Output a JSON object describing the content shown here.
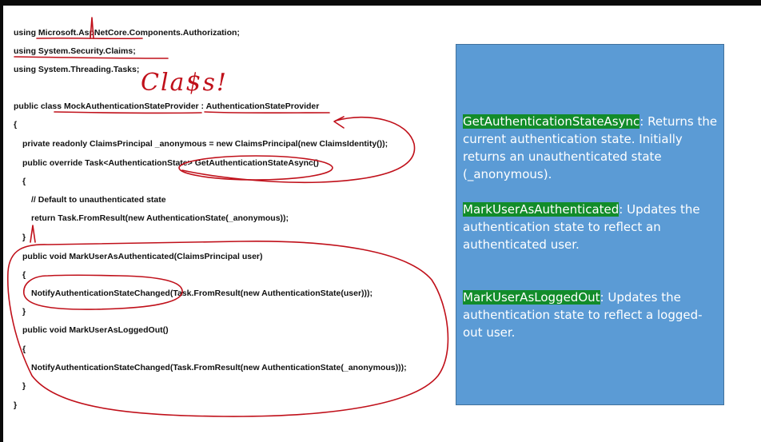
{
  "code": {
    "lines": [
      "using Microsoft.AspNetCore.Components.Authorization;",
      "using System.Security.Claims;",
      "using System.Threading.Tasks;",
      "public class MockAuthenticationStateProvider : AuthenticationStateProvider",
      "{",
      "private readonly ClaimsPrincipal _anonymous = new ClaimsPrincipal(new ClaimsIdentity());",
      "public override Task<AuthenticationState> GetAuthenticationStateAsync()",
      "{",
      "// Default to unauthenticated state",
      "return Task.FromResult(new AuthenticationState(_anonymous));",
      "}",
      "public void MarkUserAsAuthenticated(ClaimsPrincipal user)",
      "{",
      "NotifyAuthenticationStateChanged(Task.FromResult(new AuthenticationState(user)));",
      "}",
      "public void MarkUserAsLoggedOut()",
      "{",
      "NotifyAuthenticationStateChanged(Task.FromResult(new AuthenticationState(_anonymous)));",
      "}",
      "}"
    ]
  },
  "annotation": {
    "handwritten": "Cla$s!",
    "stroke_color": "#c0101a"
  },
  "info": {
    "items": [
      {
        "method": "GetAuthenticationStateAsync",
        "text": ": Returns the current authentication state. Initially returns an unauthenticated state (_anonymous)."
      },
      {
        "method": "MarkUserAsAuthenticated",
        "text": ": Updates the authentication state to reflect an authenticated user."
      },
      {
        "method": "MarkUserAsLoggedOut",
        "text": ": Updates the authentication state to reflect a logged-out user."
      }
    ],
    "box_color": "#5b9bd5",
    "highlight_color": "#128c2a"
  }
}
